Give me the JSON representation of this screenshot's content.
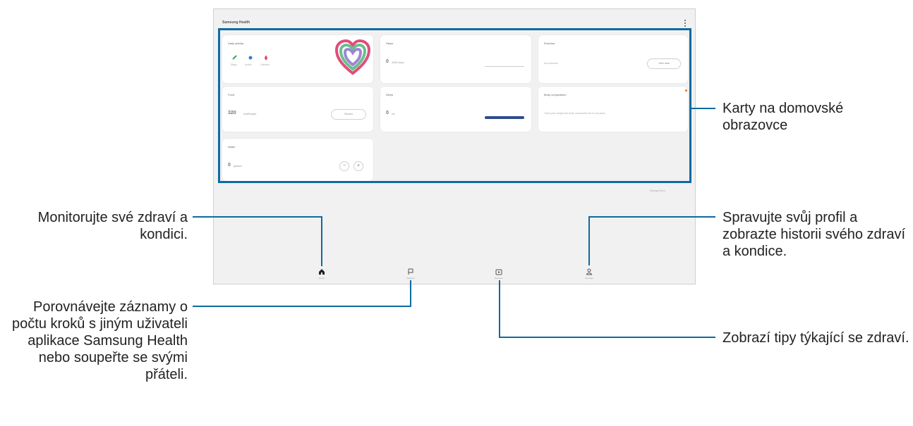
{
  "screen": {
    "title": "Samsung Health",
    "footer_link": "Manage items"
  },
  "cards": {
    "daily_activity": {
      "title": "Daily activity",
      "stats": [
        "Steps",
        "Active",
        "Calories"
      ]
    },
    "steps": {
      "title": "Steps",
      "value": "0",
      "unit": "/6000 steps"
    },
    "exercise": {
      "title": "Exercise",
      "note": "No workouts",
      "button": "View data"
    },
    "food": {
      "title": "Food",
      "value": "320",
      "unit": "kcal/Budget",
      "button": "Record"
    },
    "sleep": {
      "title": "Sleep",
      "value": "0",
      "unit": "hrs"
    },
    "body_composition": {
      "title": "Body composition",
      "note": "Track your weight and body composition all in one place."
    },
    "water": {
      "title": "Water",
      "value": "0",
      "unit": "glasses",
      "minus": "−",
      "plus": "+"
    }
  },
  "nav": {
    "home": "Home",
    "together": "Together",
    "discover": "Discover",
    "my_page": "My Page"
  },
  "callouts": {
    "home_cards": "Karty na domovské obrazovce",
    "monitor": "Monitorujte své zdraví a kondici.",
    "compare": "Porovnávejte záznamy o počtu kroků s jiným uživateli aplikace Samsung Health nebo soupeřte se svými přáteli.",
    "profile": "Spravujte svůj profil a zobrazte historii svého zdraví a kondice.",
    "tips": "Zobrazí tipy týkající se zdraví."
  },
  "colors": {
    "accent": "#0e6aa2",
    "heart_outer": "#e04d7c",
    "heart_middle": "#67c08b",
    "heart_inner": "#9f85d6",
    "sleep_bar": "#2f4b8c"
  }
}
